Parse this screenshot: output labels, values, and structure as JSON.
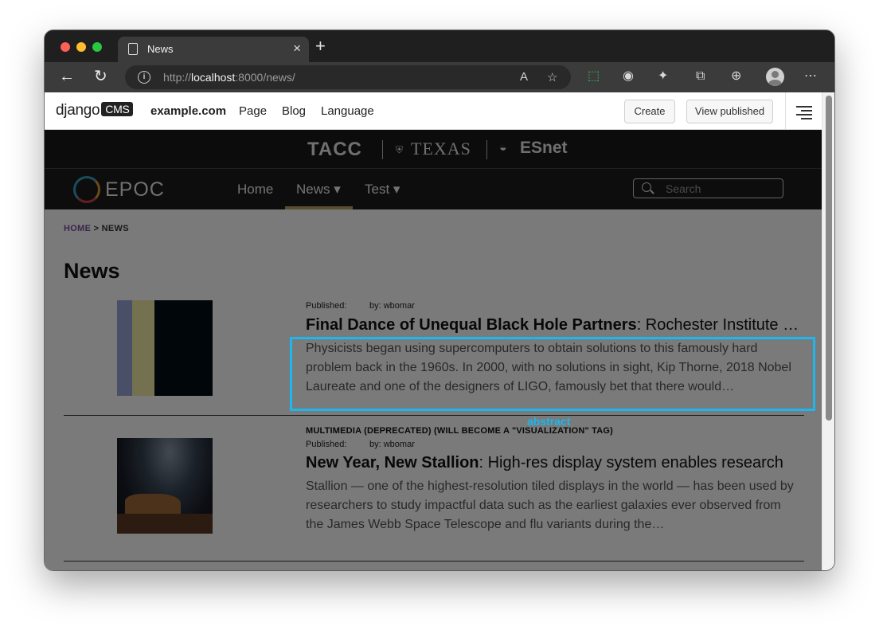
{
  "browser": {
    "tab_title": "News",
    "tab_close": "×",
    "new_tab": "+",
    "url_prefix": "http://",
    "url_host": "localhost",
    "url_rest": ":8000/news/",
    "read_aloud": "A",
    "icons": [
      "back-icon",
      "reload-icon",
      "info-icon",
      "read-aloud-icon",
      "favorite-icon",
      "screenshot-icon",
      "extension-icon",
      "puzzle-icon",
      "collections-icon",
      "shield-icon",
      "profile-icon",
      "more-icon"
    ]
  },
  "cms_toolbar": {
    "logo_text": "django",
    "logo_box": "CMS",
    "site": "example.com",
    "menu": [
      "Page",
      "Blog",
      "Language"
    ],
    "create_label": "Create",
    "view_published_label": "View published"
  },
  "partners": {
    "tacc": "TACC",
    "texas": "TEXAS",
    "esnet": "ESnet"
  },
  "site_nav": {
    "brand": "EPOC",
    "items": [
      {
        "label": "Home"
      },
      {
        "label": "News ▾"
      },
      {
        "label": "Test ▾"
      }
    ],
    "search_placeholder": "Search"
  },
  "breadcrumb": {
    "home": "HOME",
    "sep": " > ",
    "current": "NEWS"
  },
  "page": {
    "title": "News"
  },
  "articles": [
    {
      "published_label": "Published:",
      "author": "by: wbomar",
      "title_strong": "Final Dance of Unequal Black Hole Partners",
      "title_rest": ": Rochester Institute of Technology",
      "abstract": "Physicists began using supercomputers to obtain solutions to this famously hard problem back in the 1960s. In 2000, with no solutions in sight, Kip Thorne, 2018 Nobel Laureate and one of the designers of LIGO, famously bet that there would…"
    },
    {
      "tag": "MULTIMEDIA (DEPRECATED) (WILL BECOME A \"VISUALIZATION\" TAG)",
      "published_label": "Published:",
      "author": "by: wbomar",
      "title_strong": "New Year, New Stallion",
      "title_rest": ": High-res display system enables research",
      "abstract": "Stallion — one of the highest-resolution tiled displays in the world — has been used by researchers to study impactful data such as the earliest galaxies ever observed from the James Webb Space Telescope and flu variants during the…"
    }
  ],
  "annotation": {
    "label": "abstract",
    "color": "#1ab8ee"
  }
}
